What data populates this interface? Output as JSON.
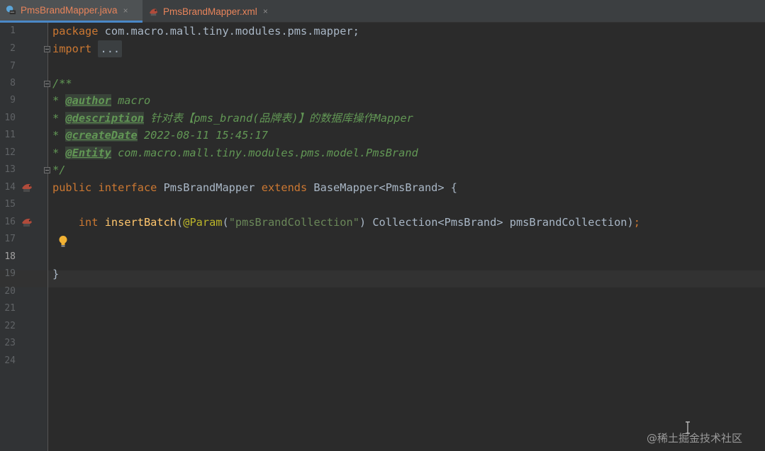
{
  "tabs": [
    {
      "label": "PmsBrandMapper.java",
      "active": true,
      "icon": "java-interface-icon"
    },
    {
      "label": "PmsBrandMapper.xml",
      "active": false,
      "icon": "xml-mybatis-icon"
    }
  ],
  "tab_close_glyph": "×",
  "line_numbers": [
    "1",
    "2",
    "7",
    "8",
    "9",
    "10",
    "11",
    "12",
    "13",
    "14",
    "15",
    "16",
    "17",
    "18",
    "19",
    "20",
    "21",
    "22",
    "23",
    "24"
  ],
  "current_line": "18",
  "code": {
    "l1_kw": "package",
    "l1_rest": " com.macro.mall.tiny.modules.pms.mapper;",
    "l2_kw": "import",
    "l2_fold": "...",
    "l8": "/**",
    "l9_star": "* ",
    "l9_tag": "@author",
    "l9_text": " macro",
    "l10_star": "* ",
    "l10_tag": "@description",
    "l10_text": " 针对表【pms_brand(品牌表)】的数据库操作Mapper",
    "l11_star": "* ",
    "l11_tag": "@createDate",
    "l11_text": " 2022-08-11 15:45:17",
    "l12_star": "* ",
    "l12_tag": "@Entity",
    "l12_text": " com.macro.mall.tiny.modules.pms.model.PmsBrand",
    "l13": "*/",
    "l14_kw1": "public",
    "l14_kw2": "interface",
    "l14_name": " PmsBrandMapper ",
    "l14_kw3": "extends",
    "l14_rest": " BaseMapper<PmsBrand> {",
    "l16_kw": "int",
    "l16_fn": "insertBatch",
    "l16_p1": "(",
    "l16_ann": "@Param",
    "l16_p2": "(",
    "l16_str": "\"pmsBrandCollection\"",
    "l16_rest": ") Collection<PmsBrand> pmsBrandCollection)",
    "l16_semi": ";",
    "l19": "}"
  },
  "watermark": "@稀土掘金技术社区",
  "colors": {
    "background": "#2b2b2b",
    "keyword": "#cc7832",
    "doc_comment": "#629755",
    "annotation": "#bbb529",
    "string": "#6a8759",
    "function": "#ffc66d",
    "tab_text": "#e8845b"
  }
}
